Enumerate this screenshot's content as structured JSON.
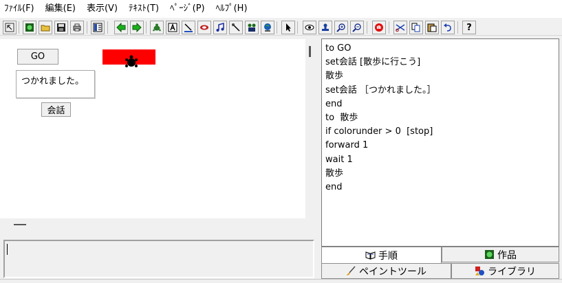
{
  "menu": [
    {
      "label": "ﾌｧｲﾙ(F)"
    },
    {
      "label": "編集(E)"
    },
    {
      "label": "表示(V)"
    },
    {
      "label": "ﾃｷｽﾄ(T)"
    },
    {
      "label": "ﾍﾟｰｼﾞ(P)"
    },
    {
      "label": "ﾍﾙﾌﾟ(H)"
    }
  ],
  "toolbar": {
    "icons": [
      "pointer-mode-icon",
      "new-page-icon",
      "open-folder-icon",
      "save-disk-icon",
      "print-icon",
      "page-layout-icon",
      "arrow-back-icon",
      "arrow-forward-icon",
      "new-turtle-icon",
      "text-box-icon",
      "draw-line-icon",
      "paint-icon",
      "music-note-icon",
      "scroll-icon",
      "video-icon",
      "globe-icon",
      "select-arrow-icon",
      "eye-icon",
      "stamp-icon",
      "zoom-in-icon",
      "zoom-out-icon",
      "stop-hand-icon",
      "cut-icon",
      "copy-icon",
      "paste-icon",
      "undo-icon",
      "help-icon"
    ],
    "help_label": "?"
  },
  "stage": {
    "go_button": "GO",
    "speech_text": "つかれました。",
    "talk_button": "会話",
    "rect_color": "#ff0000"
  },
  "editor": {
    "lines": [
      "to GO",
      "set会話 [散歩に行こう]",
      "散歩",
      "set会話 ［つかれました。］",
      "end",
      "to  散歩",
      "if colorunder > 0  [stop]",
      "forward 1",
      "wait 1",
      "散歩",
      "end"
    ]
  },
  "tabs": {
    "procedures": "手順",
    "works": "作品",
    "paint_tools": "ペイントツール",
    "library": "ライブラリ"
  }
}
